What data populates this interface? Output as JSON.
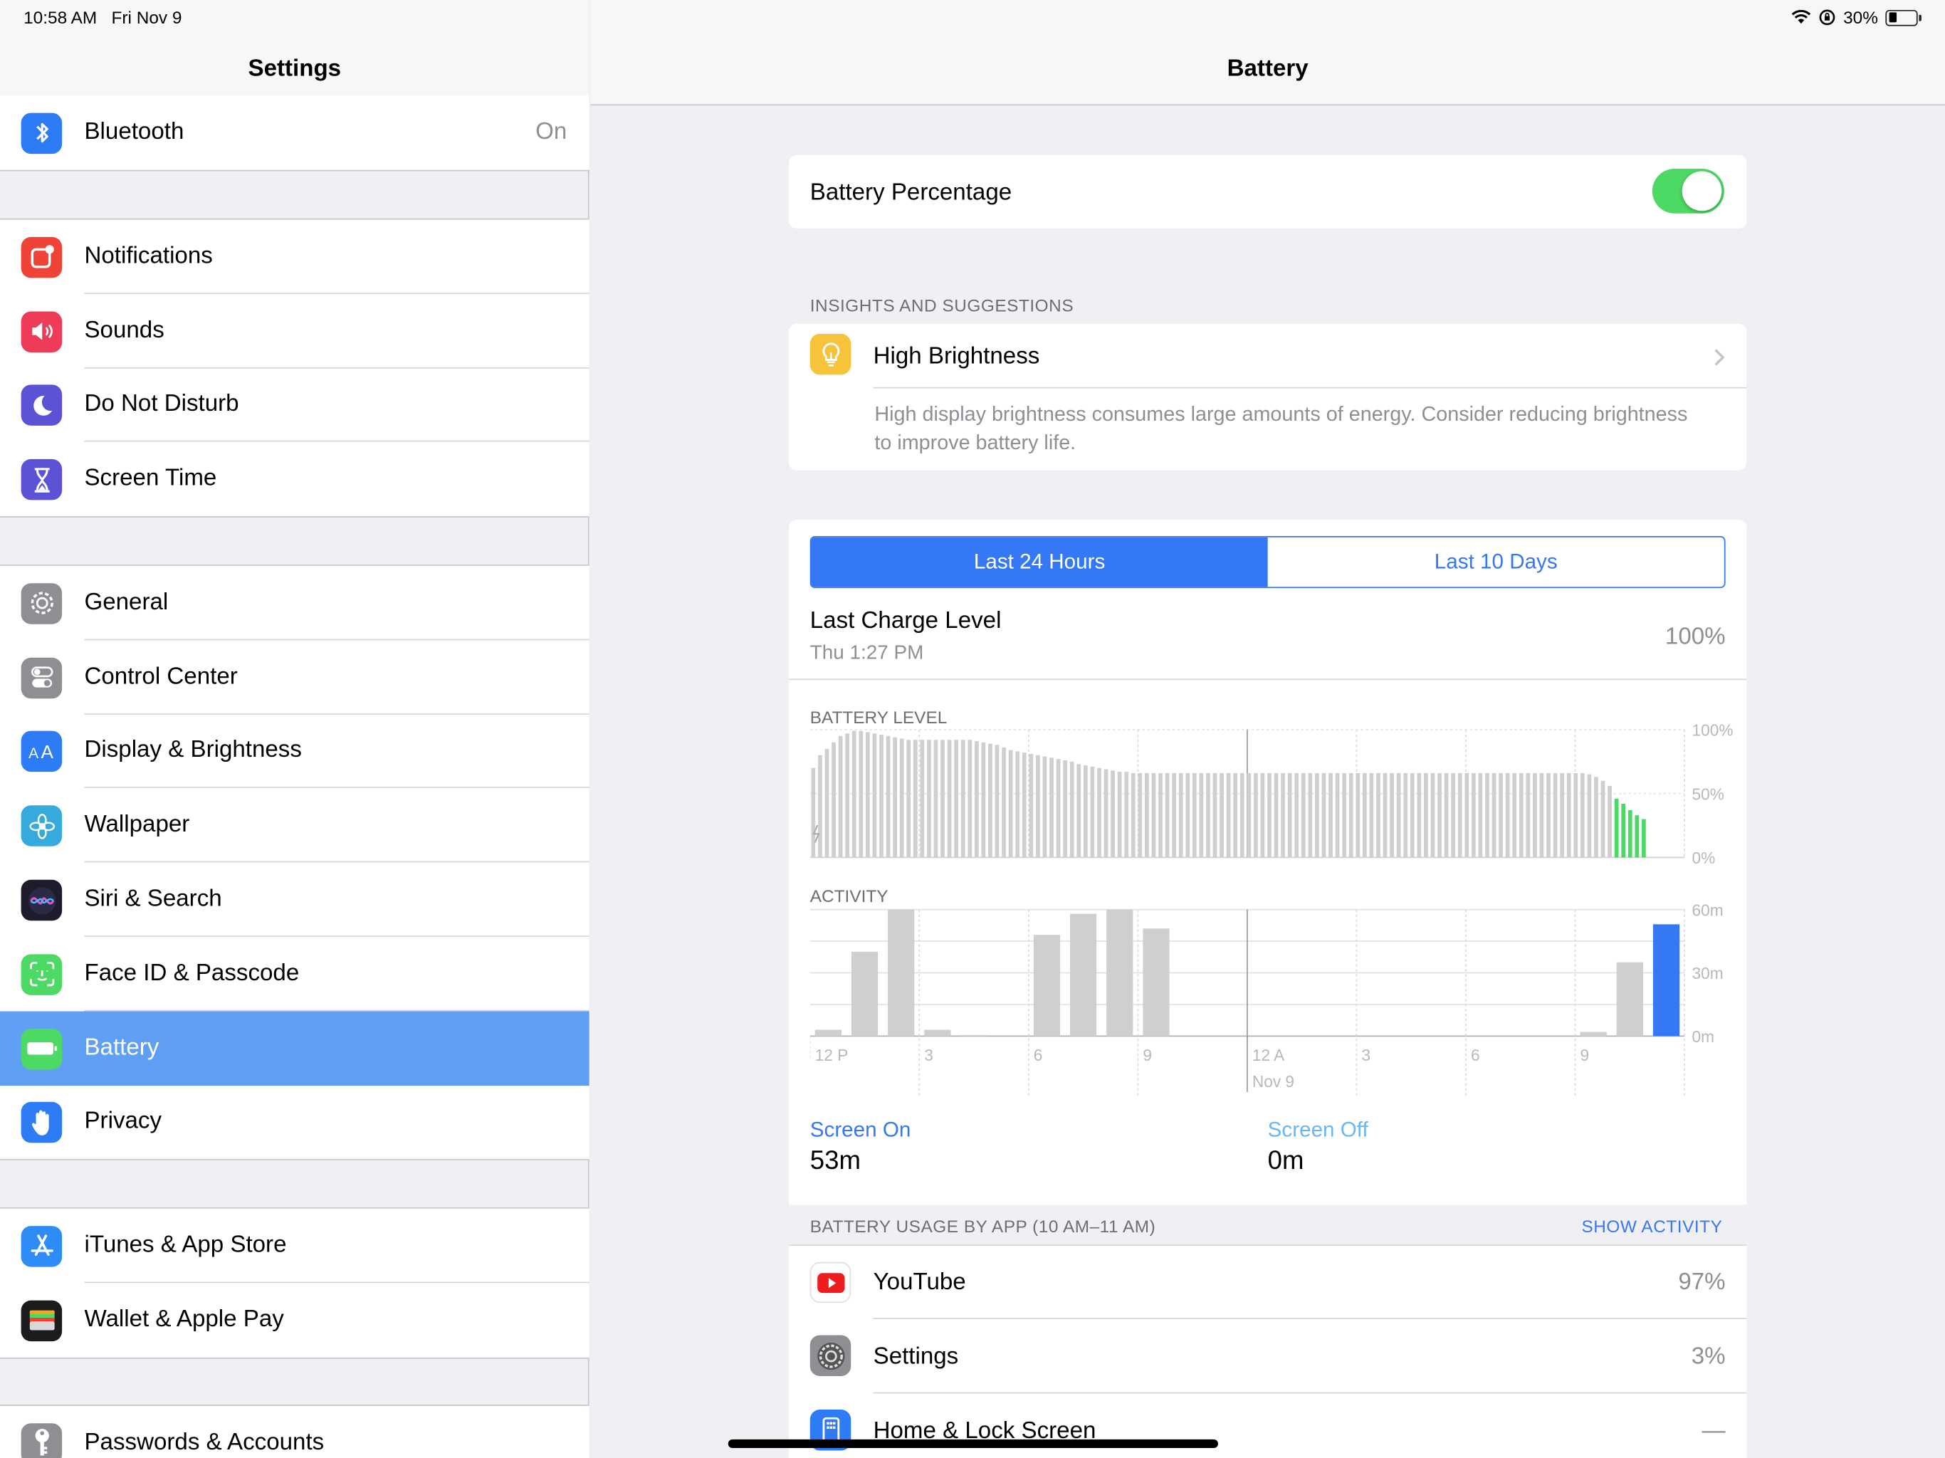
{
  "status_bar": {
    "time": "10:58 AM",
    "date": "Fri Nov 9",
    "battery_pct": "30%"
  },
  "sidebar": {
    "title": "Settings",
    "groups": [
      [
        {
          "label": "Bluetooth",
          "value": "On",
          "icon": "bluetooth-icon",
          "color": "#2d7cf6"
        }
      ],
      [
        {
          "label": "Notifications",
          "icon": "notifications-icon",
          "color": "#ee4336"
        },
        {
          "label": "Sounds",
          "icon": "speaker-icon",
          "color": "#ee3b57"
        },
        {
          "label": "Do Not Disturb",
          "icon": "moon-icon",
          "color": "#5b52d6"
        },
        {
          "label": "Screen Time",
          "icon": "hourglass-icon",
          "color": "#5b52d6"
        }
      ],
      [
        {
          "label": "General",
          "icon": "gear-icon",
          "color": "#8e8e93"
        },
        {
          "label": "Control Center",
          "icon": "toggles-icon",
          "color": "#8e8e93"
        },
        {
          "label": "Display & Brightness",
          "icon": "text-size-icon",
          "color": "#2d7cf6"
        },
        {
          "label": "Wallpaper",
          "icon": "flower-icon",
          "color": "#36aadc"
        },
        {
          "label": "Siri & Search",
          "icon": "siri-icon",
          "color": "#1c1c2c"
        },
        {
          "label": "Face ID & Passcode",
          "icon": "face-id-icon",
          "color": "#4cd964"
        },
        {
          "label": "Battery",
          "icon": "battery-icon",
          "color": "#4cd964",
          "selected": true
        },
        {
          "label": "Privacy",
          "icon": "hand-icon",
          "color": "#2d7cf6"
        }
      ],
      [
        {
          "label": "iTunes & App Store",
          "icon": "app-store-icon",
          "color": "#2d8cf6"
        },
        {
          "label": "Wallet & Apple Pay",
          "icon": "wallet-icon",
          "color": "#1c1c1e"
        }
      ],
      [
        {
          "label": "Passwords & Accounts",
          "icon": "key-icon",
          "color": "#8e8e93"
        }
      ]
    ]
  },
  "detail": {
    "title": "Battery",
    "battery_percentage_label": "Battery Percentage",
    "battery_percentage_on": true,
    "insights_header": "INSIGHTS AND SUGGESTIONS",
    "insight_title": "High Brightness",
    "insight_body": "High display brightness consumes large amounts of energy. Consider reducing brightness to improve battery life.",
    "tabs": [
      "Last 24 Hours",
      "Last 10 Days"
    ],
    "active_tab": 0,
    "last_charge_label": "Last Charge Level",
    "last_charge_time": "Thu 1:27 PM",
    "last_charge_value": "100%",
    "screen_on_label": "Screen On",
    "screen_on_value": "53m",
    "screen_off_label": "Screen Off",
    "screen_off_value": "0m",
    "usage_header": "BATTERY USAGE BY APP (10 AM–11 AM)",
    "show_activity": "SHOW ACTIVITY",
    "apps": [
      {
        "name": "YouTube",
        "value": "97%",
        "icon": "youtube-icon"
      },
      {
        "name": "Settings",
        "value": "3%",
        "icon": "settings-gear-icon"
      },
      {
        "name": "Home & Lock Screen",
        "value": "—",
        "icon": "home-screen-icon"
      }
    ]
  },
  "chart_data": [
    {
      "type": "bar",
      "title": "BATTERY LEVEL",
      "ylabels": [
        "100%",
        "50%",
        "0%"
      ],
      "ylim": [
        0,
        100
      ],
      "values": [
        70,
        80,
        85,
        90,
        95,
        97,
        99,
        99,
        98,
        97,
        96,
        95,
        94,
        93,
        92,
        92,
        92,
        92,
        92,
        92,
        92,
        92,
        92,
        92,
        91,
        90,
        89,
        88,
        86,
        84,
        83,
        82,
        81,
        80,
        79,
        78,
        77,
        76,
        75,
        73,
        72,
        71,
        70,
        69,
        68,
        67,
        67,
        66,
        66,
        66,
        66,
        66,
        66,
        66,
        66,
        66,
        66,
        66,
        66,
        66,
        66,
        66,
        66,
        66,
        66,
        66,
        66,
        66,
        66,
        66,
        66,
        66,
        66,
        66,
        66,
        66,
        66,
        66,
        66,
        66,
        66,
        66,
        66,
        66,
        66,
        66,
        66,
        66,
        66,
        66,
        66,
        66,
        66,
        66,
        66,
        66,
        66,
        66,
        66,
        66,
        66,
        66,
        66,
        66,
        66,
        66,
        66,
        66,
        66,
        66,
        66,
        66,
        66,
        66,
        65,
        63,
        60,
        56,
        46,
        42,
        37,
        33,
        30
      ],
      "green_from_index": 118,
      "charging_until_index": 1,
      "x_tick_labels": [
        "12 P",
        "3",
        "6",
        "9",
        "12 A",
        "3",
        "6",
        "9"
      ],
      "x_sub_label": "Nov 9"
    },
    {
      "type": "bar",
      "title": "ACTIVITY",
      "ylabels": [
        "60m",
        "30m",
        "0m"
      ],
      "ylim": [
        0,
        60
      ],
      "values": [
        3,
        40,
        60,
        3,
        0.5,
        0,
        48,
        58,
        60,
        51,
        0,
        0,
        0,
        0,
        0,
        0,
        0,
        0,
        0,
        0,
        0,
        2,
        35,
        53
      ],
      "highlight_index": 23
    }
  ]
}
